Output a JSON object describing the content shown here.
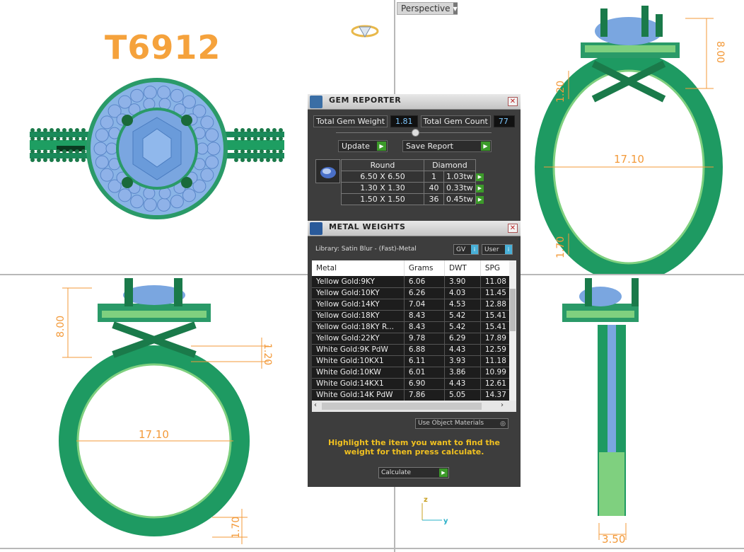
{
  "viewport": {
    "perspective_label": "Perspective",
    "axis_z": "z",
    "axis_y": "y"
  },
  "model": {
    "code": "T6912",
    "dims": {
      "top_height": "8.00",
      "top_width": "17.10",
      "top_shank": "1.20",
      "top_bottom": "1.70",
      "front_height": "8.00",
      "front_shank": "1.20",
      "front_width": "17.10",
      "front_bottom": "1.70",
      "side_width": "3.50"
    }
  },
  "gem_reporter": {
    "title": "GEM REPORTER",
    "total_weight_label": "Total Gem Weight",
    "total_weight": "1.81",
    "total_count_label": "Total Gem Count",
    "total_count": "77",
    "update_label": "Update",
    "save_label": "Save Report",
    "col_shape": "Round",
    "col_type": "Diamond",
    "rows": [
      {
        "size": "6.50 X 6.50",
        "count": "1",
        "weight": "1.03tw"
      },
      {
        "size": "1.30 X 1.30",
        "count": "40",
        "weight": "0.33tw"
      },
      {
        "size": "1.50 X 1.50",
        "count": "36",
        "weight": "0.45tw"
      }
    ]
  },
  "metal_weights": {
    "title": "METAL WEIGHTS",
    "library": "Library: Satin Blur - (Fast)-Metal",
    "gv_label": "GV",
    "user_label": "User",
    "columns": [
      "Metal",
      "Grams",
      "DWT",
      "SPG"
    ],
    "rows": [
      [
        "Yellow Gold:9KY",
        "6.06",
        "3.90",
        "11.08"
      ],
      [
        "Yellow Gold:10KY",
        "6.26",
        "4.03",
        "11.45"
      ],
      [
        "Yellow Gold:14KY",
        "7.04",
        "4.53",
        "12.88"
      ],
      [
        "Yellow Gold:18KY",
        "8.43",
        "5.42",
        "15.41"
      ],
      [
        "Yellow Gold:18KY R...",
        "8.43",
        "5.42",
        "15.41"
      ],
      [
        "Yellow Gold:22KY",
        "9.78",
        "6.29",
        "17.89"
      ],
      [
        "White Gold:9K PdW",
        "6.88",
        "4.43",
        "12.59"
      ],
      [
        "White Gold:10KX1",
        "6.11",
        "3.93",
        "11.18"
      ],
      [
        "White Gold:10KW",
        "6.01",
        "3.86",
        "10.99"
      ],
      [
        "White Gold:14KX1",
        "6.90",
        "4.43",
        "12.61"
      ],
      [
        "White Gold:14K PdW",
        "7.86",
        "5.05",
        "14.37"
      ]
    ],
    "use_object_materials": "Use Object Materials",
    "message": "Highlight the item you want to find the weight for then press calculate.",
    "calculate_label": "Calculate"
  }
}
